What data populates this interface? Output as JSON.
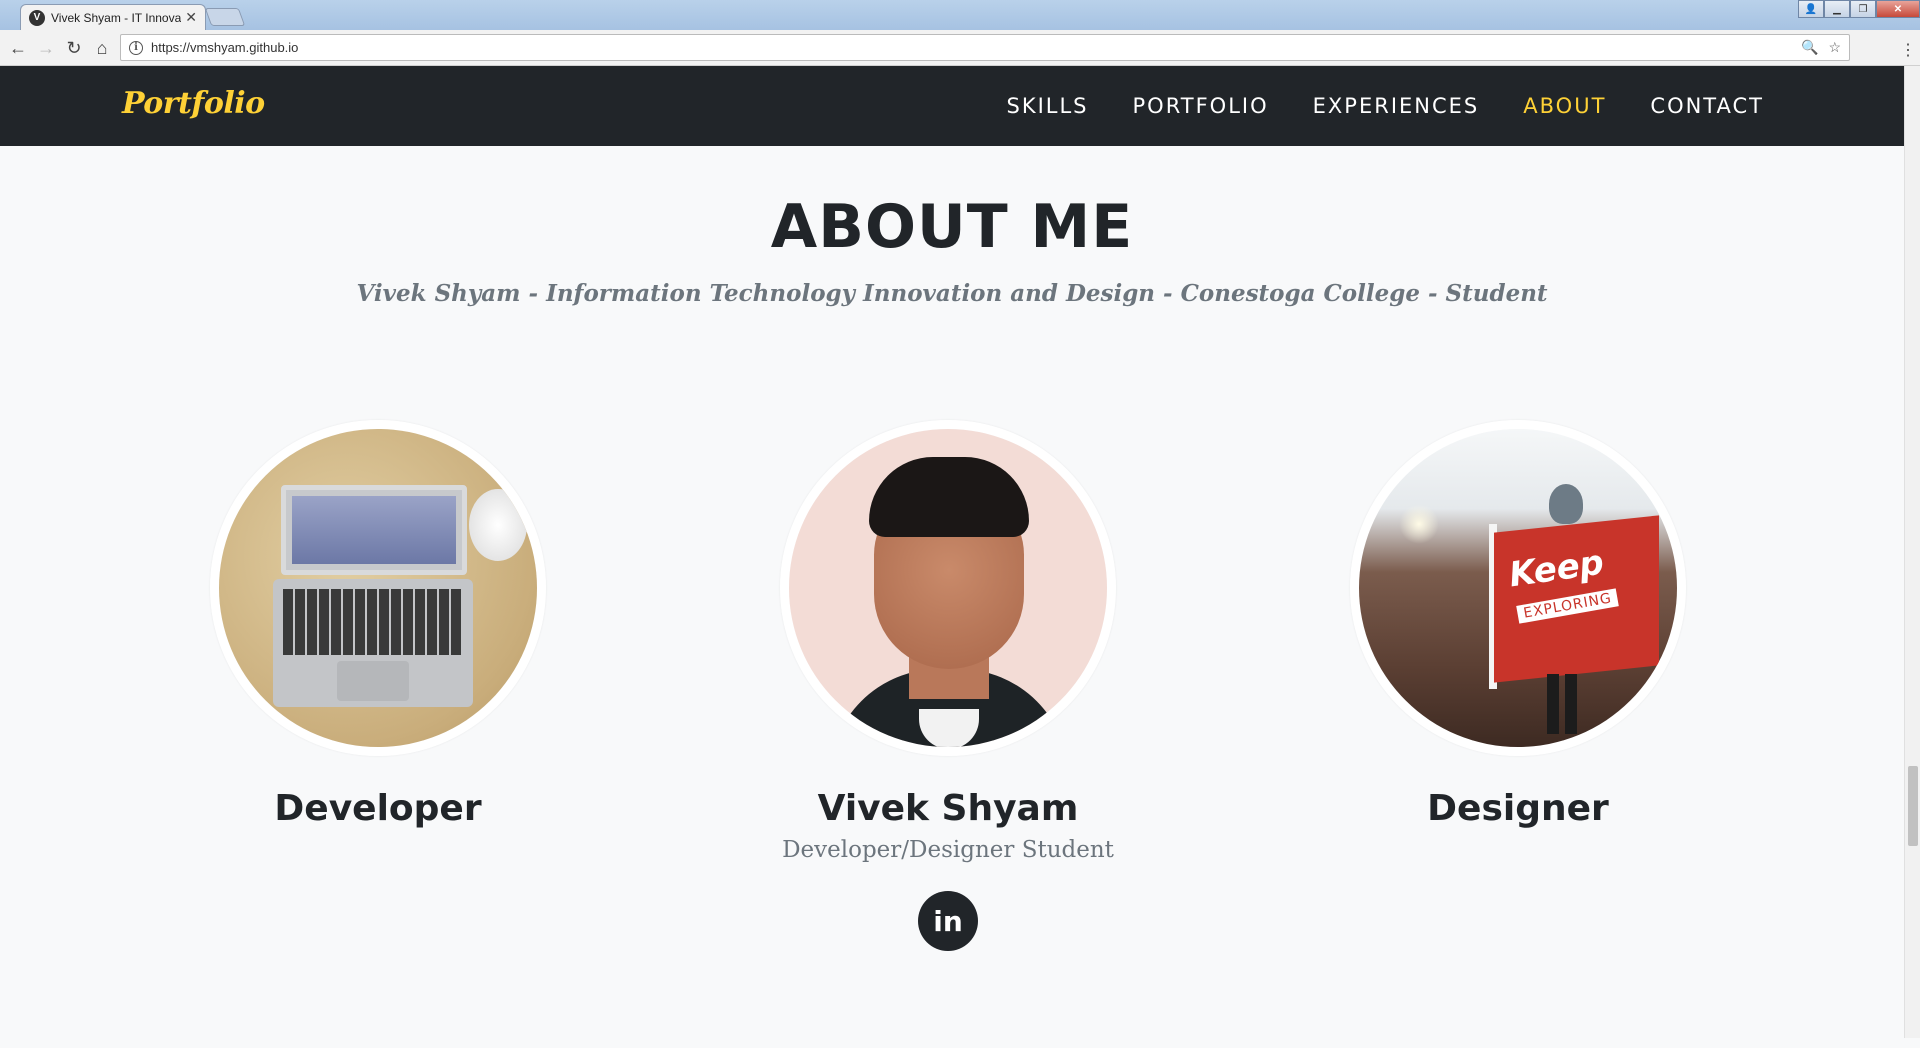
{
  "browser": {
    "tab_title": "Vivek Shyam - IT Innovat",
    "favicon_letter": "V",
    "url": "https://vmshyam.github.io"
  },
  "nav": {
    "brand": "Portfolio",
    "links": [
      "SKILLS",
      "PORTFOLIO",
      "EXPERIENCES",
      "ABOUT",
      "CONTACT"
    ],
    "active": "ABOUT"
  },
  "about": {
    "heading": "ABOUT ME",
    "subheading": "Vivek Shyam - Information Technology Innovation and Design - Conestoga College - Student"
  },
  "members": [
    {
      "name": "Developer",
      "image": "laptop-photo"
    },
    {
      "name": "Vivek Shyam",
      "role": "Developer/Designer Student",
      "image": "portrait-photo",
      "social": "in"
    },
    {
      "name": "Designer",
      "image": "keep-exploring-photo"
    }
  ],
  "explorer_flag": {
    "line1": "Keep",
    "line2": "EXPLORING"
  },
  "colors": {
    "accent": "#fed136",
    "navbar": "#212529",
    "page_bg": "#f8f9fa",
    "muted": "#6c757d"
  }
}
